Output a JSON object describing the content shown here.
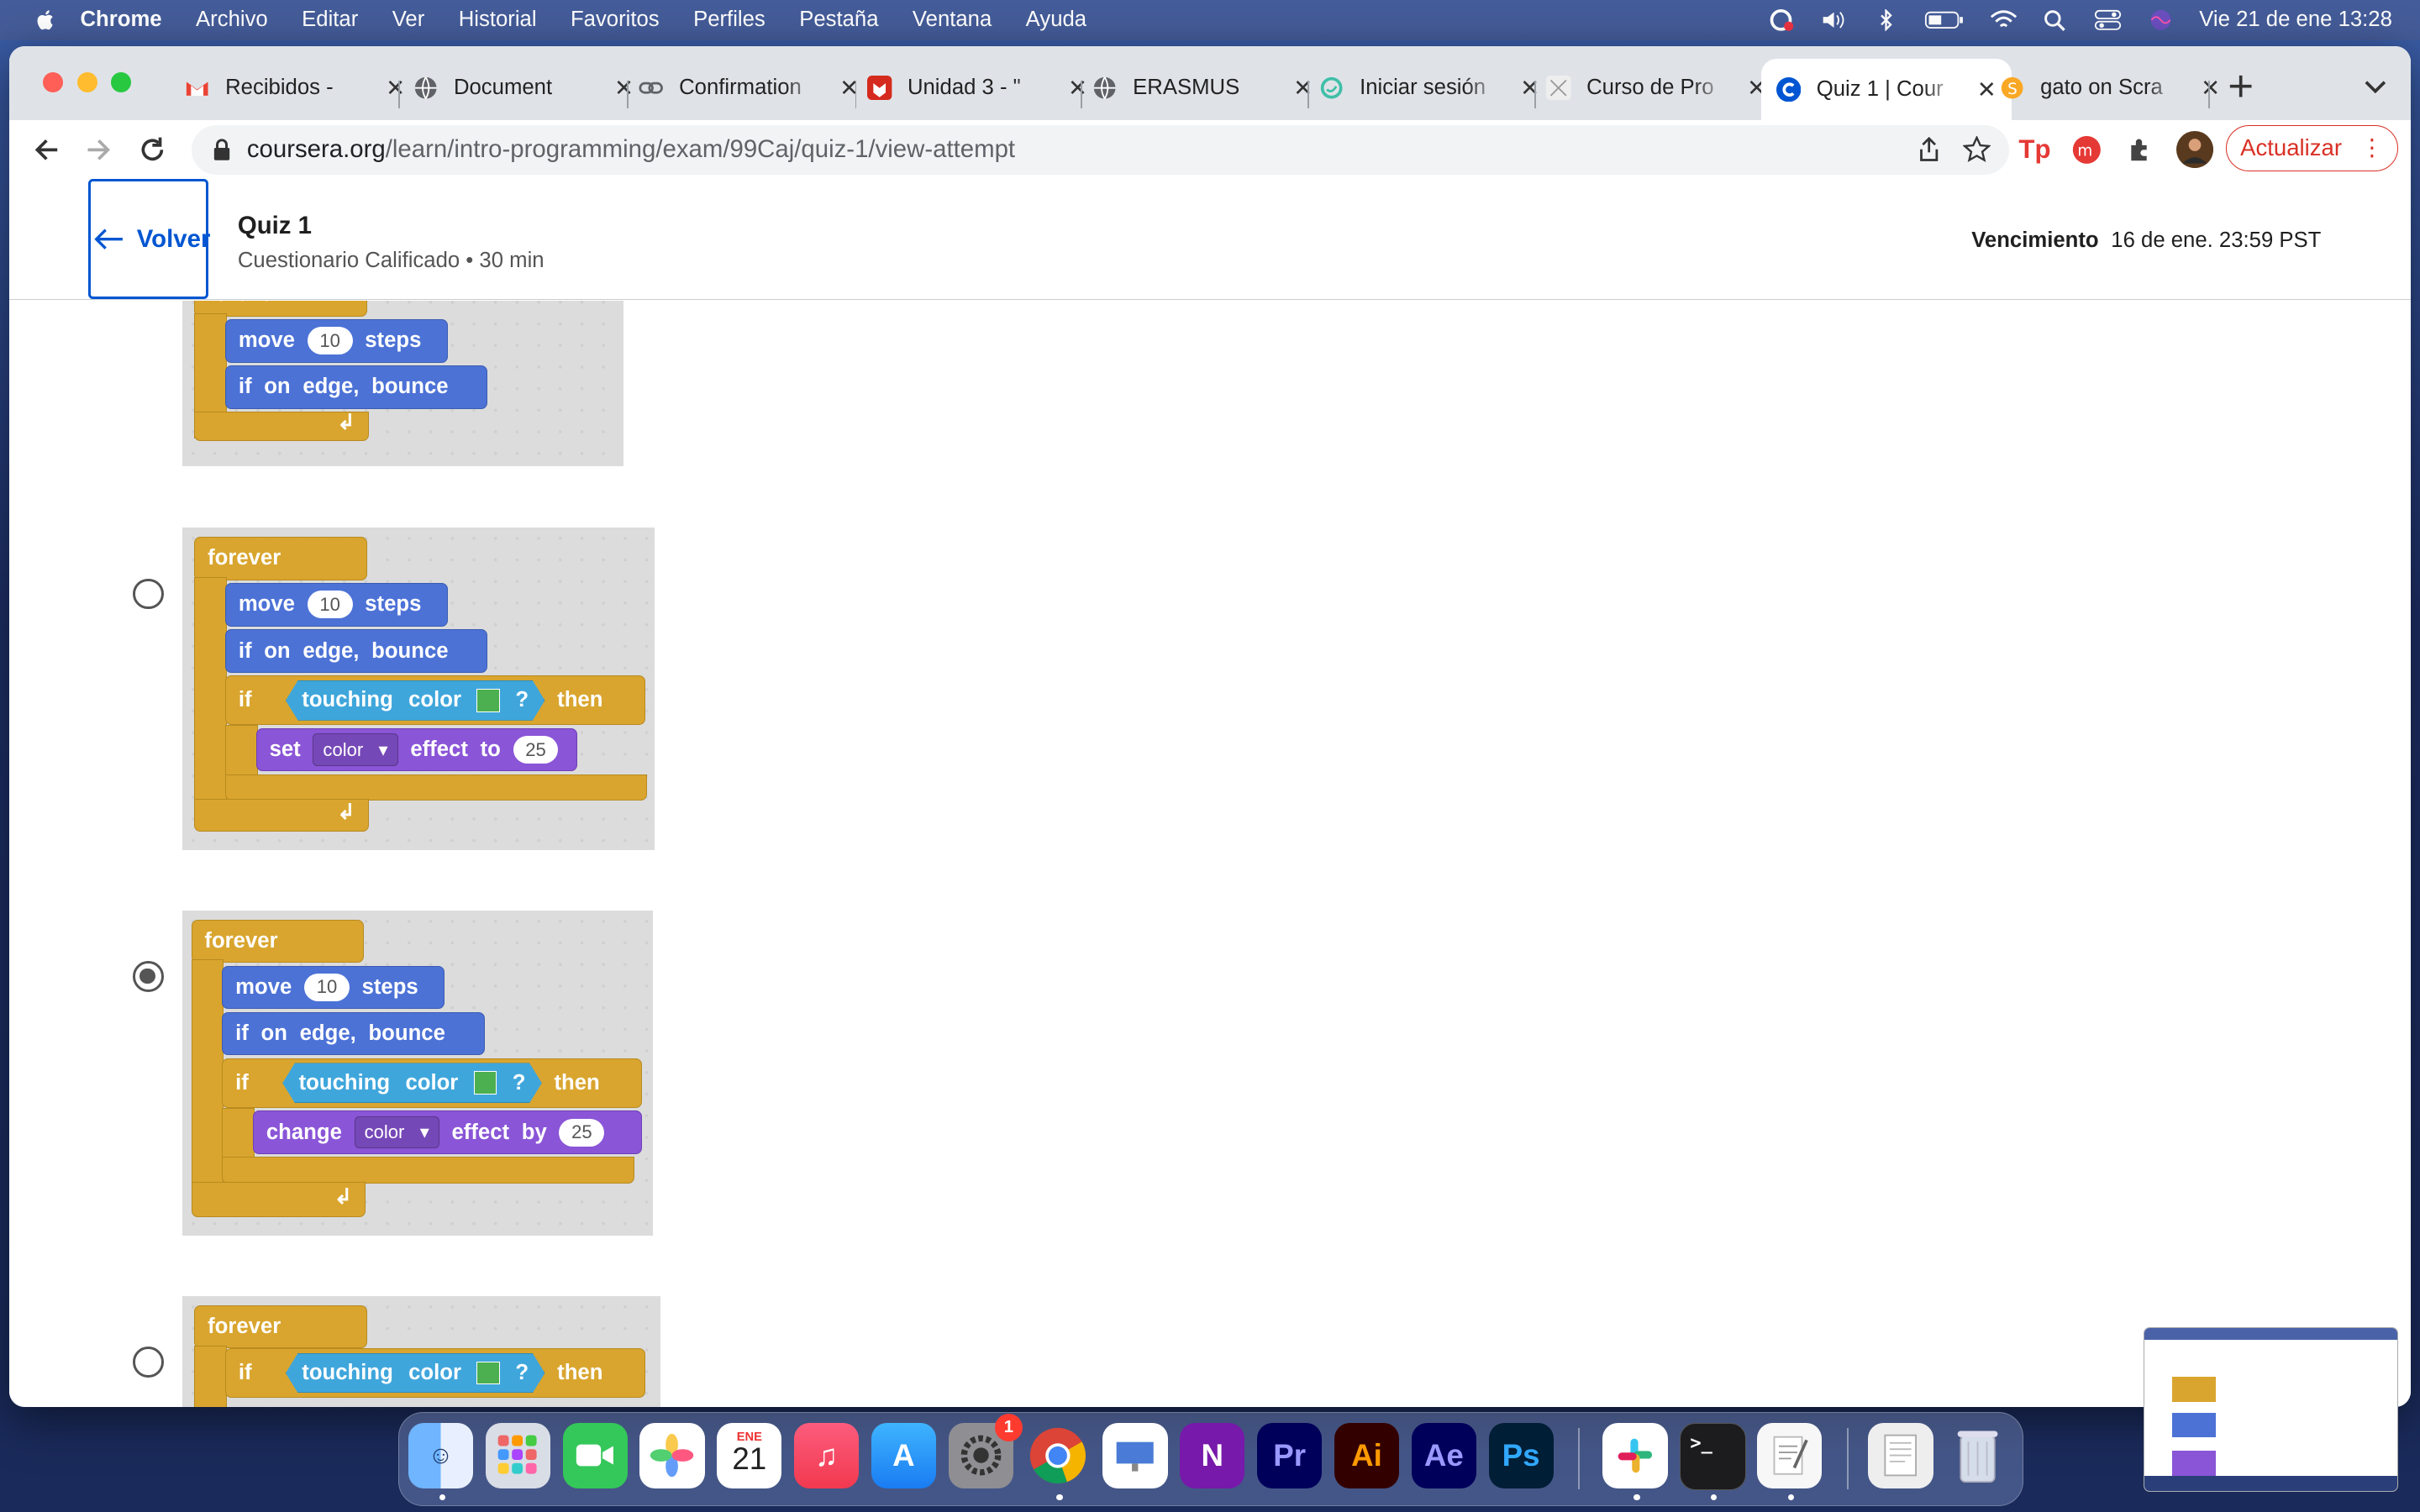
{
  "menubar": {
    "app": "Chrome",
    "items": [
      "Archivo",
      "Editar",
      "Ver",
      "Historial",
      "Favoritos",
      "Perfiles",
      "Pestaña",
      "Ventana",
      "Ayuda"
    ],
    "clock": "Vie 21 de ene  13:28"
  },
  "tabs": [
    {
      "label": "Recibidos - ",
      "icon": "gmail-icon"
    },
    {
      "label": "Document",
      "icon": "globe-icon"
    },
    {
      "label": "Confirmation",
      "icon": "link-icon"
    },
    {
      "label": "Unidad 3 - \"",
      "icon": "unidad-icon"
    },
    {
      "label": "ERASMUS",
      "icon": "globe-icon"
    },
    {
      "label": "Iniciar sesión",
      "icon": "login-icon"
    },
    {
      "label": "Curso de Pro",
      "icon": "curso-icon"
    },
    {
      "label": "Quiz 1 | Cour",
      "icon": "coursera-icon"
    },
    {
      "label": "gato on Scra",
      "icon": "scratch-icon"
    }
  ],
  "address": {
    "host": "coursera.org",
    "path": "/learn/intro-programming/exam/99Caj/quiz-1/view-attempt"
  },
  "update_button": "Actualizar",
  "header": {
    "back": "Volver",
    "title": "Quiz 1",
    "subtitle": "Cuestionario Calificado • 30 min",
    "due_label": "Vencimiento",
    "due_value": "16 de ene. 23:59 PST"
  },
  "blocks": {
    "forever": "forever",
    "move": "move",
    "steps": "steps",
    "ten": "10",
    "if_bounce": [
      "if",
      "on",
      "edge,",
      "bounce"
    ],
    "if": "if",
    "touching": "touching",
    "color": "color",
    "q": "?",
    "then": "then",
    "set": "set",
    "change": "change",
    "effect": "effect",
    "to": "to",
    "by": "by",
    "dd_color": "color",
    "twentyfive": "25"
  },
  "options": [
    {
      "selected": false
    },
    {
      "selected": false
    },
    {
      "selected": true
    },
    {
      "selected": false
    }
  ],
  "dock": {
    "apps": [
      "finder-icon",
      "launchpad-icon",
      "facetime-icon",
      "photos-icon",
      "calendar-icon",
      "music-icon",
      "appstore-icon",
      "settings-icon",
      "chrome-icon",
      "keynote-icon",
      "onenote-icon",
      "premiere-icon",
      "illustrator-icon",
      "aftereffects-icon",
      "photoshop-icon",
      "slack-icon",
      "terminal-icon",
      "textedit-icon",
      "preview-icon",
      "trash-icon"
    ],
    "calendar_month": "ENE",
    "calendar_day": "21",
    "settings_badge": "1",
    "labels": {
      "pr": "Pr",
      "ai": "Ai",
      "ae": "Ae",
      "ps": "Ps",
      "on": "N"
    }
  }
}
